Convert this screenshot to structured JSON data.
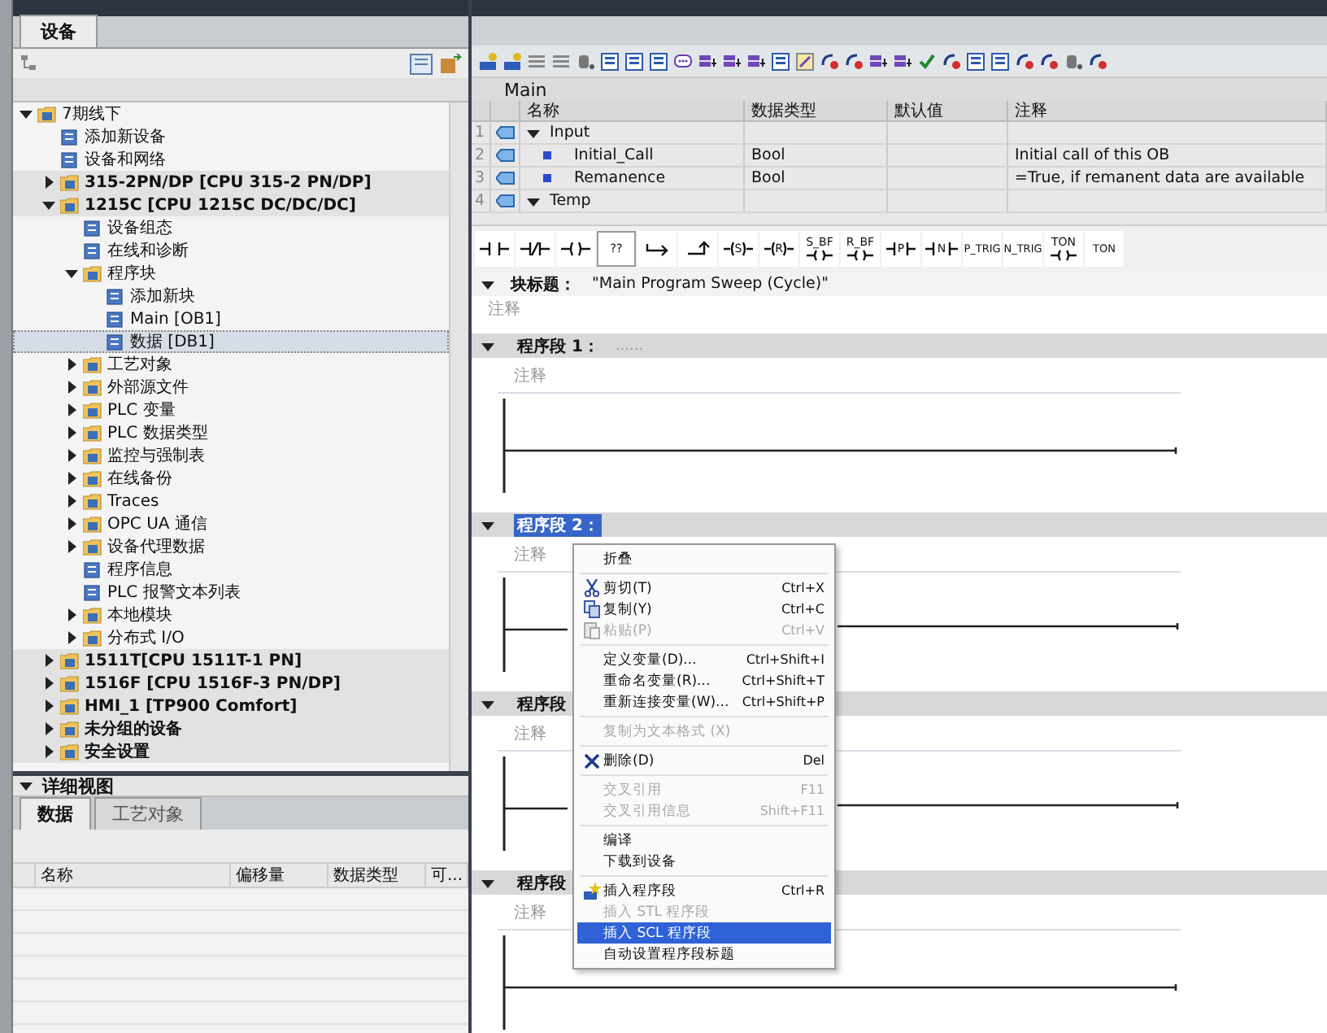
{
  "project_tree": {
    "tab": {
      "label": "设备",
      "selected": true
    },
    "items": [
      {
        "label": "7期线下",
        "expanded": true,
        "selected": false,
        "children": [
          {
            "label": "添加新设备",
            "selected": false
          },
          {
            "label": "设备和网络",
            "selected": false
          },
          {
            "label": "315-2PN/DP [CPU 315-2 PN/DP]",
            "expanded": false,
            "selected": false
          },
          {
            "label": "1215C [CPU 1215C DC/DC/DC]",
            "expanded": true,
            "selected": false,
            "children": [
              {
                "label": "设备组态",
                "selected": false
              },
              {
                "label": "在线和诊断",
                "selected": false
              },
              {
                "label": "程序块",
                "expanded": true,
                "selected": false,
                "children": [
                  {
                    "label": "添加新块",
                    "selected": false
                  },
                  {
                    "label": "Main [OB1]",
                    "selected": false
                  },
                  {
                    "label": "数据 [DB1]",
                    "selected": true
                  }
                ]
              },
              {
                "label": "工艺对象",
                "expanded": false,
                "selected": false
              },
              {
                "label": "外部源文件",
                "expanded": false,
                "selected": false
              },
              {
                "label": "PLC 变量",
                "expanded": false,
                "selected": false
              },
              {
                "label": "PLC 数据类型",
                "expanded": false,
                "selected": false
              },
              {
                "label": "监控与强制表",
                "expanded": false,
                "selected": false
              },
              {
                "label": "在线备份",
                "expanded": false,
                "selected": false
              },
              {
                "label": "Traces",
                "expanded": false,
                "selected": false
              },
              {
                "label": "OPC UA 通信",
                "expanded": false,
                "selected": false
              },
              {
                "label": "设备代理数据",
                "expanded": false,
                "selected": false
              },
              {
                "label": "程序信息",
                "selected": false
              },
              {
                "label": "PLC 报警文本列表",
                "selected": false
              },
              {
                "label": "本地模块",
                "expanded": false,
                "selected": false
              },
              {
                "label": "分布式 I/O",
                "expanded": false,
                "selected": false
              }
            ]
          },
          {
            "label": "1511T[CPU 1511T-1 PN]",
            "expanded": false,
            "selected": false
          },
          {
            "label": "1516F [CPU 1516F-3 PN/DP]",
            "expanded": false,
            "selected": false
          },
          {
            "label": "HMI_1 [TP900 Comfort]",
            "expanded": false,
            "selected": false
          },
          {
            "label": "未分组的设备",
            "expanded": false,
            "selected": false
          },
          {
            "label": "安全设置",
            "expanded": false,
            "selected": false
          }
        ]
      }
    ]
  },
  "detail_view": {
    "title": "详细视图",
    "expanded": true,
    "tabs": [
      {
        "label": "数据",
        "selected": true
      },
      {
        "label": "工艺对象",
        "selected": false
      }
    ],
    "columns": [
      "名称",
      "偏移量",
      "数据类型",
      "可..."
    ]
  },
  "block_interface": {
    "title": "Main",
    "columns": [
      "名称",
      "数据类型",
      "默认值",
      "注释"
    ],
    "rows": [
      {
        "number": "1",
        "kind": "section",
        "name": "Input",
        "expanded": true
      },
      {
        "number": "2",
        "kind": "variable",
        "name": "Initial_Call",
        "type": "Bool",
        "comment": "Initial call of this OB"
      },
      {
        "number": "3",
        "kind": "variable",
        "name": "Remanence",
        "type": "Bool",
        "comment": "=True, if remanent data are available"
      },
      {
        "number": "4",
        "kind": "section",
        "name": "Temp",
        "expanded": true
      }
    ]
  },
  "instructions": [
    {
      "kind": "contact"
    },
    {
      "kind": "nc-contact"
    },
    {
      "kind": "coil"
    },
    {
      "kind": "box",
      "label": "??"
    },
    {
      "kind": "open-branch"
    },
    {
      "kind": "close-branch"
    },
    {
      "kind": "letter-coil",
      "label": "S"
    },
    {
      "kind": "letter-coil",
      "label": "R"
    },
    {
      "kind": "top-coil",
      "label": "S_BF"
    },
    {
      "kind": "top-coil",
      "label": "R_BF"
    },
    {
      "kind": "letter-contact",
      "label": "P"
    },
    {
      "kind": "letter-contact",
      "label": "N"
    },
    {
      "kind": "text",
      "label": "P_TRIG"
    },
    {
      "kind": "text",
      "label": "N_TRIG"
    },
    {
      "kind": "top-coil",
      "label": "TON"
    },
    {
      "kind": "text",
      "label": "TON"
    }
  ],
  "block_title": {
    "label": "块标题：",
    "value": "\"Main Program Sweep (Cycle)\"",
    "comment": "注释",
    "expanded": true
  },
  "networks": [
    {
      "title": "程序段 1：",
      "placeholder": "......",
      "comment": "注释",
      "expanded": true,
      "selected": false
    },
    {
      "title": "程序段 2：",
      "comment": "注释",
      "expanded": true,
      "selected": true
    },
    {
      "title": "程序段",
      "comment": "注释",
      "expanded": true,
      "selected": false
    },
    {
      "title": "程序段",
      "comment": "注释",
      "expanded": true,
      "selected": false
    }
  ],
  "context_menu": [
    {
      "kind": "plain",
      "label": "折叠",
      "disabled": false,
      "selected": false
    },
    {
      "kind": "separator"
    },
    {
      "kind": "cut",
      "label": "剪切(T)",
      "shortcut": "Ctrl+X",
      "disabled": false,
      "selected": false
    },
    {
      "kind": "copy",
      "label": "复制(Y)",
      "shortcut": "Ctrl+C",
      "disabled": false,
      "selected": false
    },
    {
      "kind": "paste",
      "label": "粘贴(P)",
      "shortcut": "Ctrl+V",
      "disabled": true,
      "selected": false
    },
    {
      "kind": "separator"
    },
    {
      "kind": "plain",
      "label": "定义变量(D)...",
      "shortcut": "Ctrl+Shift+I",
      "disabled": false,
      "selected": false
    },
    {
      "kind": "plain",
      "label": "重命名变量(R)...",
      "shortcut": "Ctrl+Shift+T",
      "disabled": false,
      "selected": false
    },
    {
      "kind": "plain",
      "label": "重新连接变量(W)...",
      "shortcut": "Ctrl+Shift+P",
      "disabled": false,
      "selected": false
    },
    {
      "kind": "separator"
    },
    {
      "kind": "plain",
      "label": "复制为文本格式 (X)",
      "disabled": true,
      "selected": false
    },
    {
      "kind": "separator"
    },
    {
      "kind": "delete",
      "label": "删除(D)",
      "shortcut": "Del",
      "disabled": false,
      "selected": false
    },
    {
      "kind": "separator"
    },
    {
      "kind": "plain",
      "label": "交叉引用",
      "shortcut": "F11",
      "disabled": true,
      "selected": false
    },
    {
      "kind": "plain",
      "label": "交叉引用信息",
      "shortcut": "Shift+F11",
      "disabled": true,
      "selected": false
    },
    {
      "kind": "separator"
    },
    {
      "kind": "plain",
      "label": "编译",
      "disabled": false,
      "selected": false
    },
    {
      "kind": "plain",
      "label": "下载到设备",
      "disabled": false,
      "selected": false
    },
    {
      "kind": "separator"
    },
    {
      "kind": "insert",
      "label": "插入程序段",
      "shortcut": "Ctrl+R",
      "disabled": false,
      "selected": false
    },
    {
      "kind": "plain",
      "label": "插入 STL 程序段",
      "disabled": true,
      "selected": false
    },
    {
      "kind": "plain",
      "label": "插入 SCL 程序段",
      "disabled": false,
      "selected": true
    },
    {
      "kind": "plain",
      "label": "自动设置程序段标题",
      "disabled": false,
      "selected": false
    }
  ]
}
